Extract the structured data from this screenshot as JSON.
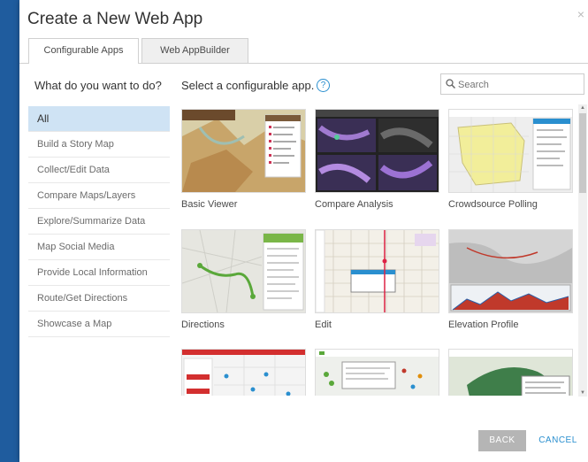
{
  "dialog": {
    "title": "Create a New Web App",
    "close_glyph": "×",
    "tabs": [
      {
        "label": "Configurable Apps",
        "active": true
      },
      {
        "label": "Web AppBuilder",
        "active": false
      }
    ],
    "question": "What do you want to do?",
    "select_prompt": "Select a configurable app.",
    "help_glyph": "?",
    "search": {
      "placeholder": "Search",
      "value": ""
    },
    "sidebar": {
      "items": [
        {
          "label": "All",
          "active": true
        },
        {
          "label": "Build a Story Map"
        },
        {
          "label": "Collect/Edit Data"
        },
        {
          "label": "Compare Maps/Layers"
        },
        {
          "label": "Explore/Summarize Data"
        },
        {
          "label": "Map Social Media"
        },
        {
          "label": "Provide Local Information"
        },
        {
          "label": "Route/Get Directions"
        },
        {
          "label": "Showcase a Map"
        }
      ]
    },
    "apps": [
      {
        "label": "Basic Viewer"
      },
      {
        "label": "Compare Analysis"
      },
      {
        "label": "Crowdsource Polling"
      },
      {
        "label": "Directions"
      },
      {
        "label": "Edit"
      },
      {
        "label": "Elevation Profile"
      },
      {
        "label": ""
      },
      {
        "label": ""
      },
      {
        "label": ""
      }
    ],
    "buttons": {
      "back": "BACK",
      "cancel": "CANCEL"
    },
    "colors": {
      "accent": "#2a8fcf",
      "sidebar_active": "#cfe3f4",
      "backdrop": "#1f5c9e",
      "back_button": "#b5b5b5"
    }
  }
}
